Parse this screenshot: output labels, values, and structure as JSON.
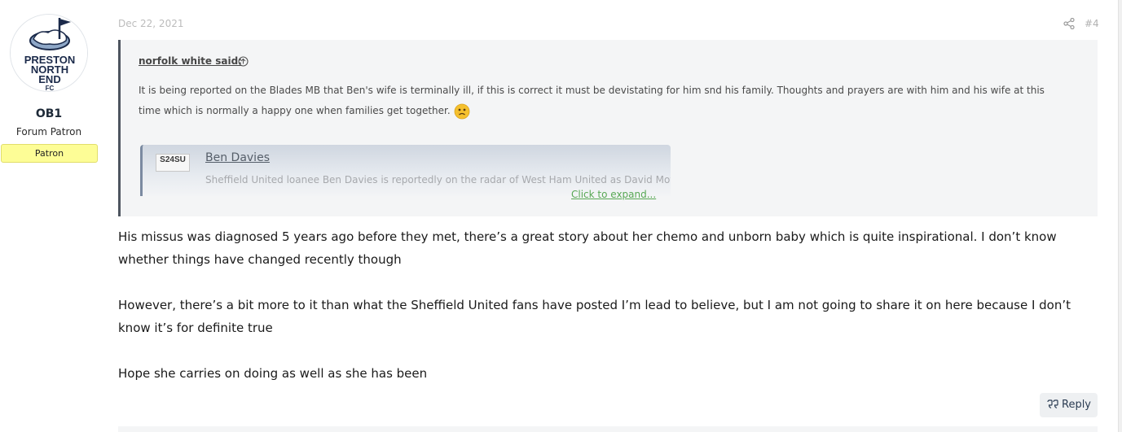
{
  "user": {
    "avatar_text": [
      "PRESTON",
      "NORTH",
      "END",
      "FC"
    ],
    "name": "OB1",
    "title": "Forum Patron",
    "banner": "Patron"
  },
  "post": {
    "date": "Dec 22, 2021",
    "number": "#4",
    "quote": {
      "author": "norfolk white said:",
      "text": "It is being reported on the Blades MB that Ben's wife is terminally ill, if this is correct it must be devistating for him snd his family. Thoughts and prayers are with him and his wife at this time which is normally a happy one when families get together.",
      "embed": {
        "logo": "S24SU",
        "title": "Ben Davies",
        "description": "Sheffield United loanee Ben Davies is reportedly on the radar of West Ham United as David Moyes"
      },
      "expand_label": "Click to expand..."
    },
    "paragraphs": [
      "His missus was diagnosed 5 years ago before they met, there’s a great story about her chemo and unborn baby which is quite inspirational. I don’t know whether things have changed recently though",
      "However, there’s a bit more to it than what the Sheffield United fans have posted I’m lead to believe, but I am not going to share it on here because I don’t know it’s for definite true",
      "Hope she carries on doing as well as she has been"
    ],
    "reply_label": "Reply"
  },
  "colors": {
    "banner_bg": "#fdfd96",
    "quote_bg": "#f4f5f6",
    "expand_link": "#58a854",
    "username": "#1e2a38"
  },
  "icons": {
    "share": "share-icon",
    "quote_jump": "arrow-circle-up-icon",
    "emoji": "sad-face-emoji-icon",
    "reply": "quote-marks-icon"
  }
}
